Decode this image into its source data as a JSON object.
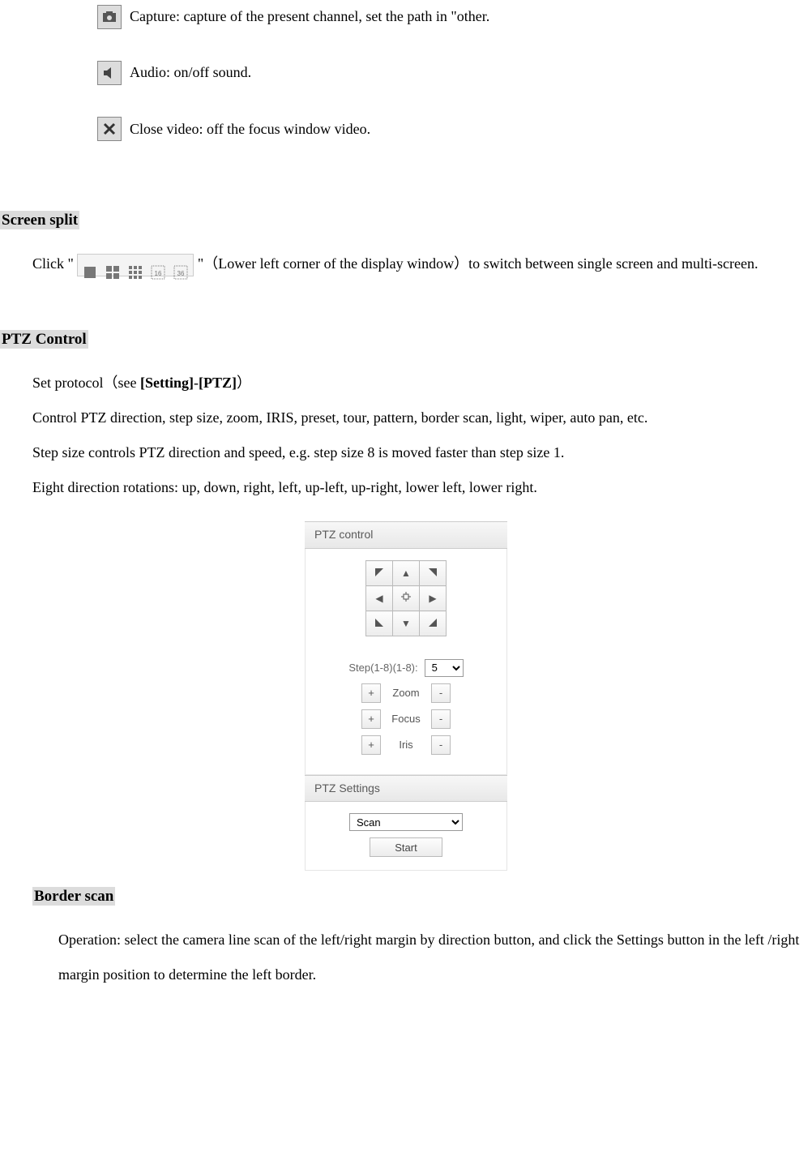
{
  "icons": {
    "capture": {
      "text": "Capture: capture of the present channel, set the path in \"other."
    },
    "audio": {
      "text": "Audio: on/off sound."
    },
    "close": {
      "text": "Close video: off the focus window video."
    }
  },
  "screen_split": {
    "heading": "Screen split",
    "before": "Click \" ",
    "after": " \"（Lower left corner of the display window）to switch between single screen and multi-screen."
  },
  "ptz_control": {
    "heading": "PTZ Control",
    "line1a": "Set protocol（see ",
    "line1b": "[Setting]",
    "line1c": "-",
    "line1d": "[PTZ]",
    "line1e": "）",
    "line2": "Control PTZ direction, step size, zoom, IRIS, preset, tour, pattern, border scan, light, wiper, auto pan, etc.",
    "line3": "Step size controls PTZ direction and speed, e.g. step size 8 is moved faster than step size 1.",
    "line4": "Eight direction rotations: up, down, right, left, up-left, up-right, lower left, lower right."
  },
  "ptz_panel": {
    "title": "PTZ control",
    "step_label": "Step(1-8)(1-8):",
    "step_value": "5",
    "zoom": "Zoom",
    "focus": "Focus",
    "iris": "Iris",
    "settings_title": "PTZ Settings",
    "scan_value": "Scan",
    "start": "Start",
    "plus": "+",
    "minus": "-"
  },
  "border_scan": {
    "heading": "Border scan",
    "text": "Operation: select the camera line scan of the left/right margin by direction button, and click the Settings button in the left /right margin position to determine the left border."
  }
}
